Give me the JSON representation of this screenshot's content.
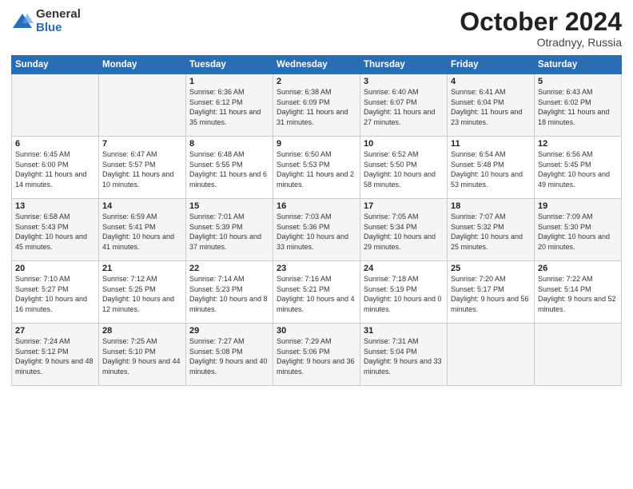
{
  "header": {
    "logo_general": "General",
    "logo_blue": "Blue",
    "month": "October 2024",
    "location": "Otradnyy, Russia"
  },
  "days_of_week": [
    "Sunday",
    "Monday",
    "Tuesday",
    "Wednesday",
    "Thursday",
    "Friday",
    "Saturday"
  ],
  "weeks": [
    [
      {
        "day": "",
        "sunrise": "",
        "sunset": "",
        "daylight": ""
      },
      {
        "day": "",
        "sunrise": "",
        "sunset": "",
        "daylight": ""
      },
      {
        "day": "1",
        "sunrise": "Sunrise: 6:36 AM",
        "sunset": "Sunset: 6:12 PM",
        "daylight": "Daylight: 11 hours and 35 minutes."
      },
      {
        "day": "2",
        "sunrise": "Sunrise: 6:38 AM",
        "sunset": "Sunset: 6:09 PM",
        "daylight": "Daylight: 11 hours and 31 minutes."
      },
      {
        "day": "3",
        "sunrise": "Sunrise: 6:40 AM",
        "sunset": "Sunset: 6:07 PM",
        "daylight": "Daylight: 11 hours and 27 minutes."
      },
      {
        "day": "4",
        "sunrise": "Sunrise: 6:41 AM",
        "sunset": "Sunset: 6:04 PM",
        "daylight": "Daylight: 11 hours and 23 minutes."
      },
      {
        "day": "5",
        "sunrise": "Sunrise: 6:43 AM",
        "sunset": "Sunset: 6:02 PM",
        "daylight": "Daylight: 11 hours and 18 minutes."
      }
    ],
    [
      {
        "day": "6",
        "sunrise": "Sunrise: 6:45 AM",
        "sunset": "Sunset: 6:00 PM",
        "daylight": "Daylight: 11 hours and 14 minutes."
      },
      {
        "day": "7",
        "sunrise": "Sunrise: 6:47 AM",
        "sunset": "Sunset: 5:57 PM",
        "daylight": "Daylight: 11 hours and 10 minutes."
      },
      {
        "day": "8",
        "sunrise": "Sunrise: 6:48 AM",
        "sunset": "Sunset: 5:55 PM",
        "daylight": "Daylight: 11 hours and 6 minutes."
      },
      {
        "day": "9",
        "sunrise": "Sunrise: 6:50 AM",
        "sunset": "Sunset: 5:53 PM",
        "daylight": "Daylight: 11 hours and 2 minutes."
      },
      {
        "day": "10",
        "sunrise": "Sunrise: 6:52 AM",
        "sunset": "Sunset: 5:50 PM",
        "daylight": "Daylight: 10 hours and 58 minutes."
      },
      {
        "day": "11",
        "sunrise": "Sunrise: 6:54 AM",
        "sunset": "Sunset: 5:48 PM",
        "daylight": "Daylight: 10 hours and 53 minutes."
      },
      {
        "day": "12",
        "sunrise": "Sunrise: 6:56 AM",
        "sunset": "Sunset: 5:45 PM",
        "daylight": "Daylight: 10 hours and 49 minutes."
      }
    ],
    [
      {
        "day": "13",
        "sunrise": "Sunrise: 6:58 AM",
        "sunset": "Sunset: 5:43 PM",
        "daylight": "Daylight: 10 hours and 45 minutes."
      },
      {
        "day": "14",
        "sunrise": "Sunrise: 6:59 AM",
        "sunset": "Sunset: 5:41 PM",
        "daylight": "Daylight: 10 hours and 41 minutes."
      },
      {
        "day": "15",
        "sunrise": "Sunrise: 7:01 AM",
        "sunset": "Sunset: 5:39 PM",
        "daylight": "Daylight: 10 hours and 37 minutes."
      },
      {
        "day": "16",
        "sunrise": "Sunrise: 7:03 AM",
        "sunset": "Sunset: 5:36 PM",
        "daylight": "Daylight: 10 hours and 33 minutes."
      },
      {
        "day": "17",
        "sunrise": "Sunrise: 7:05 AM",
        "sunset": "Sunset: 5:34 PM",
        "daylight": "Daylight: 10 hours and 29 minutes."
      },
      {
        "day": "18",
        "sunrise": "Sunrise: 7:07 AM",
        "sunset": "Sunset: 5:32 PM",
        "daylight": "Daylight: 10 hours and 25 minutes."
      },
      {
        "day": "19",
        "sunrise": "Sunrise: 7:09 AM",
        "sunset": "Sunset: 5:30 PM",
        "daylight": "Daylight: 10 hours and 20 minutes."
      }
    ],
    [
      {
        "day": "20",
        "sunrise": "Sunrise: 7:10 AM",
        "sunset": "Sunset: 5:27 PM",
        "daylight": "Daylight: 10 hours and 16 minutes."
      },
      {
        "day": "21",
        "sunrise": "Sunrise: 7:12 AM",
        "sunset": "Sunset: 5:25 PM",
        "daylight": "Daylight: 10 hours and 12 minutes."
      },
      {
        "day": "22",
        "sunrise": "Sunrise: 7:14 AM",
        "sunset": "Sunset: 5:23 PM",
        "daylight": "Daylight: 10 hours and 8 minutes."
      },
      {
        "day": "23",
        "sunrise": "Sunrise: 7:16 AM",
        "sunset": "Sunset: 5:21 PM",
        "daylight": "Daylight: 10 hours and 4 minutes."
      },
      {
        "day": "24",
        "sunrise": "Sunrise: 7:18 AM",
        "sunset": "Sunset: 5:19 PM",
        "daylight": "Daylight: 10 hours and 0 minutes."
      },
      {
        "day": "25",
        "sunrise": "Sunrise: 7:20 AM",
        "sunset": "Sunset: 5:17 PM",
        "daylight": "Daylight: 9 hours and 56 minutes."
      },
      {
        "day": "26",
        "sunrise": "Sunrise: 7:22 AM",
        "sunset": "Sunset: 5:14 PM",
        "daylight": "Daylight: 9 hours and 52 minutes."
      }
    ],
    [
      {
        "day": "27",
        "sunrise": "Sunrise: 7:24 AM",
        "sunset": "Sunset: 5:12 PM",
        "daylight": "Daylight: 9 hours and 48 minutes."
      },
      {
        "day": "28",
        "sunrise": "Sunrise: 7:25 AM",
        "sunset": "Sunset: 5:10 PM",
        "daylight": "Daylight: 9 hours and 44 minutes."
      },
      {
        "day": "29",
        "sunrise": "Sunrise: 7:27 AM",
        "sunset": "Sunset: 5:08 PM",
        "daylight": "Daylight: 9 hours and 40 minutes."
      },
      {
        "day": "30",
        "sunrise": "Sunrise: 7:29 AM",
        "sunset": "Sunset: 5:06 PM",
        "daylight": "Daylight: 9 hours and 36 minutes."
      },
      {
        "day": "31",
        "sunrise": "Sunrise: 7:31 AM",
        "sunset": "Sunset: 5:04 PM",
        "daylight": "Daylight: 9 hours and 33 minutes."
      },
      {
        "day": "",
        "sunrise": "",
        "sunset": "",
        "daylight": ""
      },
      {
        "day": "",
        "sunrise": "",
        "sunset": "",
        "daylight": ""
      }
    ]
  ]
}
